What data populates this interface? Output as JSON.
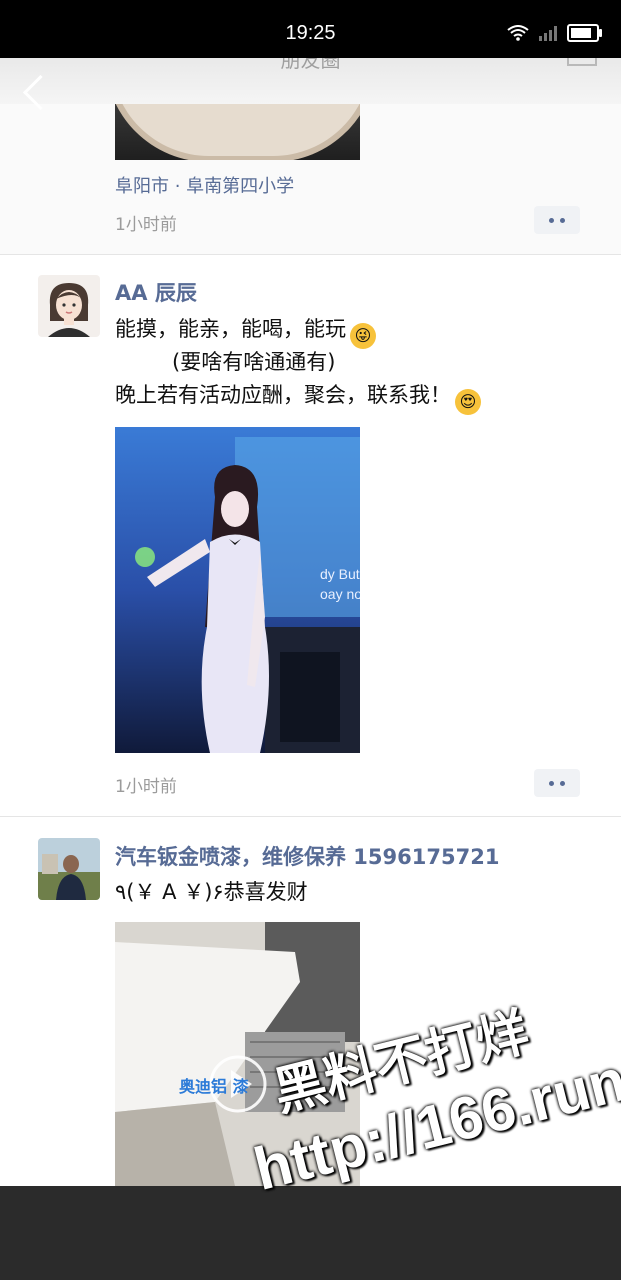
{
  "status_bar": {
    "time": "19:25",
    "battery_level": 0.85
  },
  "header": {
    "title": "朋友圈"
  },
  "posts": [
    {
      "location": "阜阳市 · 阜南第四小学",
      "time_ago": "1小时前"
    },
    {
      "nickname": "AA 辰辰",
      "lines": [
        "能摸，能亲，能喝，能玩",
        "(要啥有啥通通有)",
        "晚上若有活动应酬，聚会，联系我！"
      ],
      "emojis": [
        "wink-face-emoji",
        "heart-eyes-emoji"
      ],
      "photo_text": [
        "dy But-Y",
        "oay nobo"
      ],
      "time_ago": "1小时前"
    },
    {
      "nickname": "汽车钣金喷漆，维修保养 1596175721",
      "line": "٩(￥ A ￥)۶恭喜发财",
      "video_caption": "奥迪铝  漆"
    }
  ],
  "watermark": {
    "line1": "黑料不打烊",
    "line2": "http://166.run"
  },
  "colors": {
    "link_blue": "#576b95",
    "grey_text": "#9b9b9b",
    "status_bar": "#000000"
  }
}
